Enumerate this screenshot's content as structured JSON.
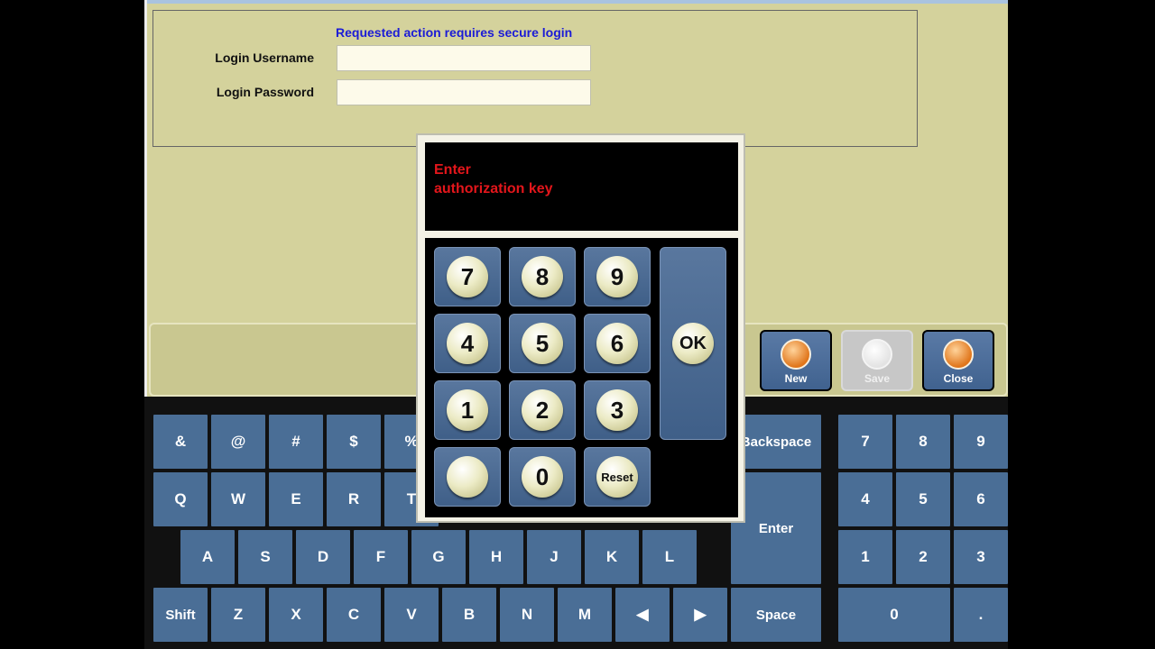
{
  "login": {
    "message": "Requested action requires secure login",
    "username_label": "Login Username",
    "password_label": "Login Password",
    "username_value": "",
    "password_value": ""
  },
  "toolbar": {
    "new_label": "New",
    "save_label": "Save",
    "close_label": "Close"
  },
  "keyboard": {
    "symbols": [
      "&",
      "@",
      "#",
      "$",
      "%"
    ],
    "row_q": [
      "Q",
      "W",
      "E",
      "R",
      "T"
    ],
    "row_a": [
      "A",
      "S",
      "D",
      "F",
      "G",
      "H",
      "J",
      "K",
      "L"
    ],
    "row_z": [
      "Shift",
      "Z",
      "X",
      "C",
      "V",
      "B",
      "N",
      "M",
      "◀",
      "▶"
    ],
    "backspace_label": "Backspace",
    "enter_label": "Enter",
    "space_label": "Space",
    "numpad": [
      "7",
      "8",
      "9",
      "4",
      "5",
      "6",
      "1",
      "2",
      "3"
    ],
    "numpad_zero": "0",
    "numpad_dot": "."
  },
  "auth_dialog": {
    "prompt": "Enter authorization key",
    "keys": [
      "7",
      "8",
      "9",
      "4",
      "5",
      "6",
      "1",
      "2",
      "3"
    ],
    "blank_key": "",
    "zero_key": "0",
    "reset_label": "Reset",
    "ok_label": "OK"
  }
}
